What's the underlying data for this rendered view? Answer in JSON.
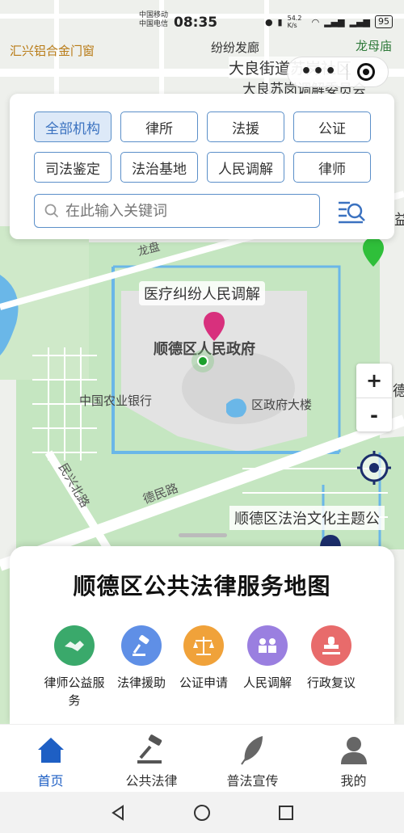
{
  "status": {
    "carrier1": "中国移动",
    "carrier2": "中国电信",
    "time": "08:35",
    "speed": "54.2 K/s",
    "battery": "95"
  },
  "map_labels": {
    "poi_1": "汇兴铝合金门窗",
    "poi_2": "纷纷发廊",
    "poi_3": "龙母庙",
    "poi_4": "大良街道苏岗社区",
    "poi_5": "大良苏岗调解委员会",
    "poi_6": "医疗纠纷人民调解",
    "poi_7": "顺德区人民政府",
    "poi_8": "中国农业银行",
    "poi_9": "区政府大楼",
    "poi_10": "顺德区法治文化主题公",
    "road_1": "德民路",
    "road_2": "民兴北路",
    "road_3": "龙盘",
    "edge_1": "德",
    "edge_2": "益"
  },
  "filters": {
    "row1": [
      "全部机构",
      "律所",
      "法援",
      "公证"
    ],
    "row2": [
      "司法鉴定",
      "法治基地",
      "人民调解",
      "律师"
    ],
    "active_index": 0
  },
  "search": {
    "placeholder": "在此输入关键词"
  },
  "zoom": {
    "plus": "+",
    "minus": "-"
  },
  "sheet": {
    "title": "顺德区公共法律服务地图",
    "services": [
      {
        "label": "律师公益服务",
        "icon": "handshake-icon",
        "color": "#3aa96b"
      },
      {
        "label": "法律援助",
        "icon": "gavel-icon",
        "color": "#5f8fe6"
      },
      {
        "label": "公证申请",
        "icon": "scales-icon",
        "color": "#f0a23a"
      },
      {
        "label": "人民调解",
        "icon": "people-icon",
        "color": "#9a7fe0"
      },
      {
        "label": "行政复议",
        "icon": "stamp-icon",
        "color": "#e86b6b"
      }
    ]
  },
  "tabs": [
    {
      "label": "首页",
      "icon": "home-icon"
    },
    {
      "label": "公共法律",
      "icon": "gavel-icon"
    },
    {
      "label": "普法宣传",
      "icon": "feather-icon"
    },
    {
      "label": "我的",
      "icon": "user-icon"
    }
  ],
  "active_tab": 0,
  "colors": {
    "accent": "#1e5fc4",
    "chip_border": "#5b8fc9",
    "park_green": "#c5e6c1",
    "water": "#6ab7e8"
  }
}
